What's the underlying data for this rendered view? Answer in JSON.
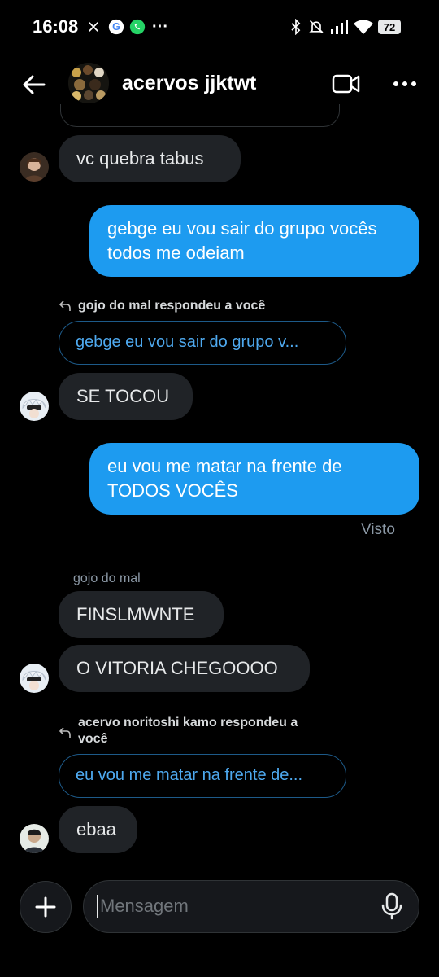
{
  "status_bar": {
    "time": "16:08",
    "battery": "72"
  },
  "header": {
    "title": "acervos jjktwt"
  },
  "messages": [
    {
      "text": "vc quebra tabus"
    },
    {
      "text": "gebge eu vou sair do grupo vocês todos me odeiam"
    },
    {
      "reply_label": "gojo do mal respondeu a você",
      "reply_preview": "gebge eu vou sair do grupo v...",
      "text": "SE TOCOU"
    },
    {
      "text": "eu vou me matar na frente de TODOS VOCÊS",
      "seen": "Visto"
    },
    {
      "sender": "gojo do mal",
      "text": "FINSLMWNTE"
    },
    {
      "text": "O VITORIA CHEGOOOO"
    },
    {
      "reply_label": "acervo noritoshi kamo respondeu a você",
      "reply_preview": "eu vou me matar na frente de...",
      "text": "ebaa"
    }
  ],
  "composer": {
    "placeholder": "Mensagem"
  },
  "colors": {
    "accent": "#1d9bf0",
    "bubble_in": "#202327",
    "background": "#000000"
  },
  "icons": [
    "x-logo-icon",
    "google-icon",
    "whatsapp-icon",
    "bluetooth-icon",
    "mute-icon",
    "signal-icon",
    "wifi-icon",
    "back-arrow-icon",
    "video-call-icon",
    "more-icon",
    "reply-icon",
    "plus-icon",
    "microphone-icon"
  ]
}
